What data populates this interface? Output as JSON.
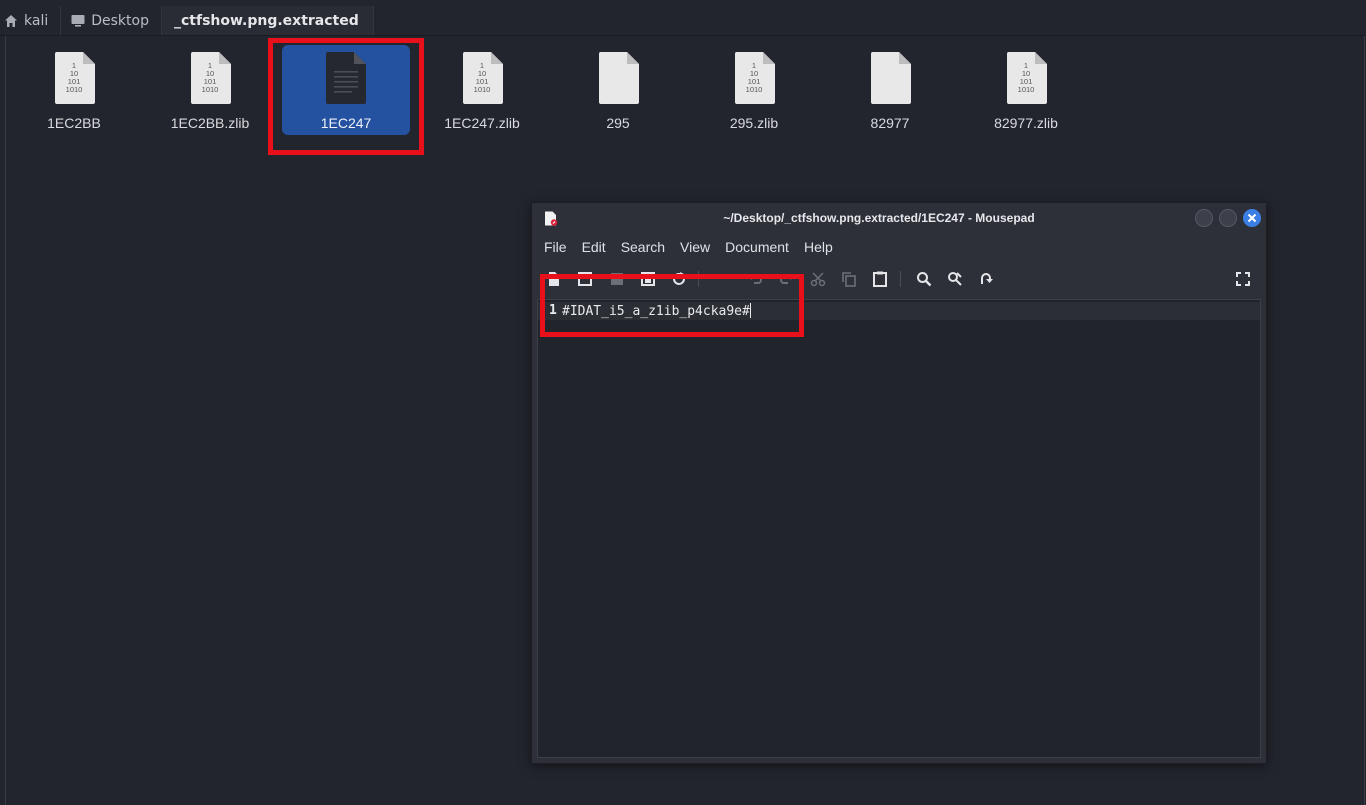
{
  "breadcrumb": [
    {
      "label": "kali",
      "icon": "home-icon"
    },
    {
      "label": "Desktop",
      "icon": "desktop-icon"
    },
    {
      "label": "_ctfshow.png.extracted",
      "icon": ""
    }
  ],
  "files": [
    {
      "name": "1EC2BB",
      "icon": "binary-file-icon",
      "binary_text": [
        "1",
        "10",
        "101",
        "1010"
      ]
    },
    {
      "name": "1EC2BB.zlib",
      "icon": "binary-file-icon",
      "binary_text": [
        "1",
        "10",
        "101",
        "1010"
      ]
    },
    {
      "name": "1EC247",
      "icon": "text-file-icon",
      "selected": true
    },
    {
      "name": "1EC247.zlib",
      "icon": "binary-file-icon",
      "binary_text": [
        "1",
        "10",
        "101",
        "1010"
      ]
    },
    {
      "name": "295",
      "icon": "blank-file-icon"
    },
    {
      "name": "295.zlib",
      "icon": "binary-file-icon",
      "binary_text": [
        "1",
        "10",
        "101",
        "1010"
      ]
    },
    {
      "name": "82977",
      "icon": "blank-file-icon"
    },
    {
      "name": "82977.zlib",
      "icon": "binary-file-icon",
      "binary_text": [
        "1",
        "10",
        "101",
        "1010"
      ]
    }
  ],
  "window": {
    "title": "~/Desktop/_ctfshow.png.extracted/1EC247 - Mousepad",
    "menu": [
      "File",
      "Edit",
      "Search",
      "View",
      "Document",
      "Help"
    ],
    "toolbar": [
      "new-document-icon",
      "new-window-icon",
      "save-icon",
      "save-as-icon",
      "reload-icon",
      "undo-icon",
      "redo-icon",
      "cut-icon",
      "copy-icon",
      "paste-icon",
      "search-icon",
      "replace-icon",
      "goto-line-icon",
      "fullscreen-icon"
    ],
    "editor": {
      "line_number": "1",
      "content": "#IDAT_i5_a_z1ib_p4cka9e#"
    }
  },
  "colors": {
    "background": "#23252e",
    "selection": "#2452a0",
    "highlight": "#e8101a",
    "close_button": "#3a7ee6"
  }
}
